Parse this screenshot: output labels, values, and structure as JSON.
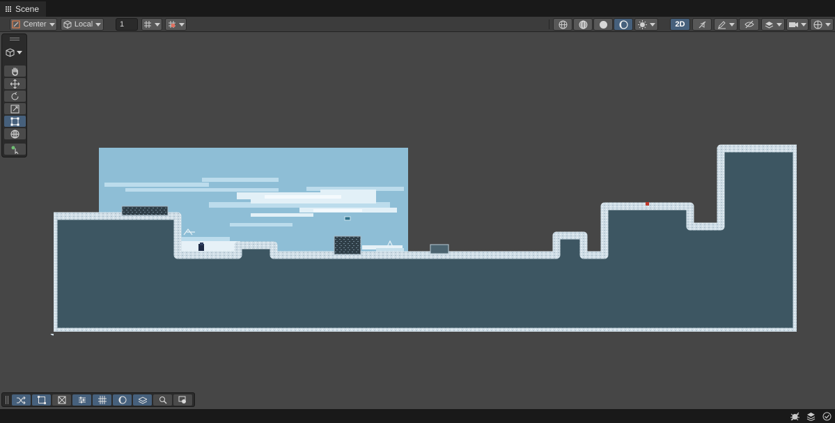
{
  "window": {
    "tab_label": "Scene"
  },
  "toolbar": {
    "pivot_mode": "Center",
    "pivot_rotation": "Local",
    "grid_snap_value": "1",
    "mode_2d_label": "2D",
    "pivot_mode_icon": "pivot-center-icon",
    "pivot_rotation_icon": "cube-local-icon"
  },
  "tools_overlay": {
    "view_options": "cube-icon",
    "tools": [
      {
        "name": "hand-tool",
        "icon": "hand-icon",
        "active": false
      },
      {
        "name": "move-tool",
        "icon": "move-arrows-icon",
        "active": false
      },
      {
        "name": "rotate-tool",
        "icon": "rotate-icon",
        "active": false
      },
      {
        "name": "scale-tool",
        "icon": "scale-icon",
        "active": false
      },
      {
        "name": "rect-tool",
        "icon": "rect-transform-icon",
        "active": true
      },
      {
        "name": "transform-tool",
        "icon": "transform-globe-icon",
        "active": false
      },
      {
        "name": "custom-tool",
        "icon": "custom-editor-tool-icon",
        "active": false
      }
    ]
  },
  "bottom_overlay": {
    "buttons": [
      "shuffle-icon",
      "rect-select-icon",
      "no-box-icon",
      "sliders-icon",
      "grid-hatch-icon",
      "lighting-half-moon-icon",
      "layers-stack-icon",
      "search-icon",
      "camera-icon"
    ]
  },
  "colors": {
    "sky": "#8ebed6",
    "ground": "#3d5662",
    "snow": "#d7e4ec",
    "active_button": "#46607c",
    "background": "#464646"
  }
}
